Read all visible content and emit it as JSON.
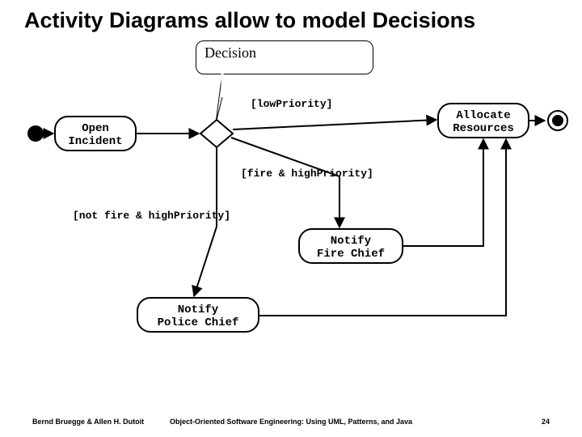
{
  "title": "Activity Diagrams allow to model Decisions",
  "callout": "Decision",
  "nodes": {
    "open_incident": {
      "line1": "Open",
      "line2": "Incident"
    },
    "allocate_resources": {
      "line1": "Allocate",
      "line2": "Resources"
    },
    "notify_fire_chief": {
      "line1": "Notify",
      "line2": "Fire Chief"
    },
    "notify_police_chief": {
      "line1": "Notify",
      "line2": "Police Chief"
    }
  },
  "guards": {
    "low_priority": "[lowPriority]",
    "fire_high": "[fire & highPriority]",
    "not_fire_high": "[not fire & highPriority]"
  },
  "footer": {
    "left": "Bernd Bruegge & Allen H. Dutoit",
    "center": "Object-Oriented Software Engineering: Using UML, Patterns, and Java",
    "page": "24"
  }
}
